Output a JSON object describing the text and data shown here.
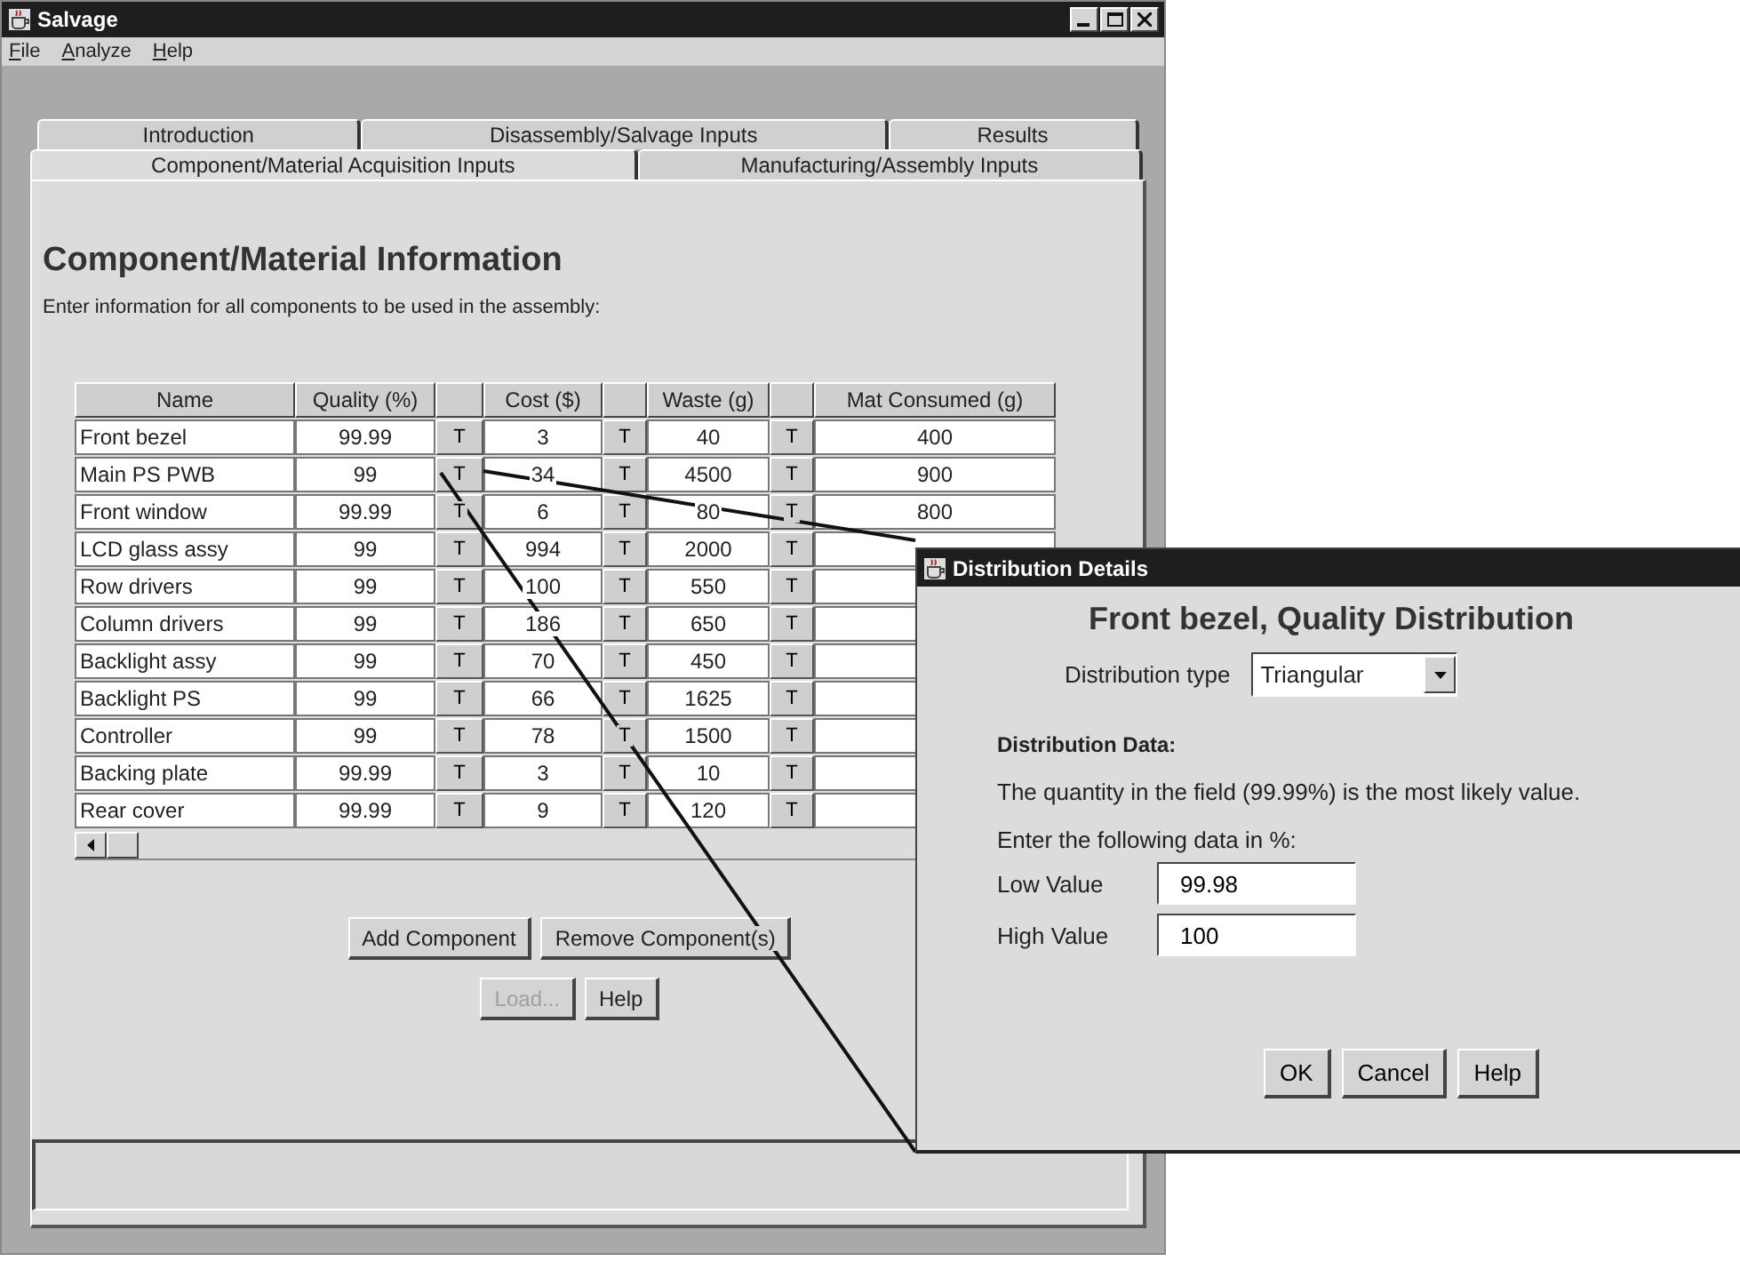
{
  "window": {
    "title": "Salvage"
  },
  "menu": [
    {
      "label": "File"
    },
    {
      "label": "Analyze"
    },
    {
      "label": "Help"
    }
  ],
  "tab_rows": [
    {
      "tabs": [
        {
          "label": "Introduction",
          "selected": false
        },
        {
          "label": "Disassembly/Salvage Inputs",
          "selected": false
        },
        {
          "label": "Results",
          "selected": false
        }
      ]
    },
    {
      "tabs": [
        {
          "label": "Component/Material Acquisition Inputs",
          "selected": true
        },
        {
          "label": "Manufacturing/Assembly Inputs",
          "selected": false
        }
      ]
    }
  ],
  "heading": "Component/Material Information",
  "instructions": "Enter information for all components to be used in the assembly:",
  "table": {
    "columns": [
      "Name",
      "Quality (%)",
      "Cost ($)",
      "Waste (g)",
      "Mat Consumed (g)"
    ],
    "rows": [
      {
        "name": "Front bezel",
        "quality": "99.99",
        "cost": "3",
        "waste": "40",
        "mat": "400",
        "t_buttons": [
          "T",
          "T",
          "T"
        ]
      },
      {
        "name": "Main PS PWB",
        "quality": "99",
        "cost": "34",
        "waste": "4500",
        "mat": "900",
        "t_buttons": [
          "T",
          "T",
          "T"
        ]
      },
      {
        "name": "Front window",
        "quality": "99.99",
        "cost": "6",
        "waste": "80",
        "mat": "800",
        "t_buttons": [
          "T",
          "T",
          "T"
        ]
      },
      {
        "name": "LCD glass assy",
        "quality": "99",
        "cost": "994",
        "waste": "2000",
        "t_buttons": [
          "T",
          "T",
          "T"
        ]
      },
      {
        "name": "Row drivers",
        "quality": "99",
        "cost": "100",
        "waste": "550",
        "t_buttons": [
          "T",
          "T",
          "T"
        ]
      },
      {
        "name": "Column drivers",
        "quality": "99",
        "cost": "186",
        "waste": "650",
        "t_buttons": [
          "T",
          "T",
          "T"
        ]
      },
      {
        "name": "Backlight assy",
        "quality": "99",
        "cost": "70",
        "waste": "450",
        "t_buttons": [
          "T",
          "T",
          "T"
        ]
      },
      {
        "name": "Backlight PS",
        "quality": "99",
        "cost": "66",
        "waste": "1625",
        "t_buttons": [
          "T",
          "T",
          "T"
        ]
      },
      {
        "name": "Controller",
        "quality": "99",
        "cost": "78",
        "waste": "1500",
        "t_buttons": [
          "T",
          "T",
          "T"
        ]
      },
      {
        "name": "Backing plate",
        "quality": "99.99",
        "cost": "3",
        "waste": "10",
        "t_buttons": [
          "T",
          "T",
          "T"
        ]
      },
      {
        "name": "Rear cover",
        "quality": "99.99",
        "cost": "9",
        "waste": "120",
        "t_buttons": [
          "T",
          "T",
          "T"
        ]
      }
    ]
  },
  "buttons": [
    [
      {
        "label": "Add Component",
        "disabled": false
      },
      {
        "label": "Remove Component(s)",
        "disabled": false
      }
    ],
    [
      {
        "label": "Load...",
        "disabled": true
      },
      {
        "label": "Help",
        "disabled": false
      }
    ]
  ],
  "dialog": {
    "title": "Distribution Details",
    "heading": "Front bezel, Quality Distribution",
    "type_label": "Distribution type",
    "type_value": "Triangular",
    "section": "Distribution Data:",
    "note": "The quantity in the field (99.99%) is the most likely value.",
    "prompt": "Enter the following data in %:",
    "fields": [
      {
        "label": "Low Value",
        "value": "99.98"
      },
      {
        "label": "High Value",
        "value": "100"
      }
    ],
    "buttons": [
      "OK",
      "Cancel",
      "Help"
    ]
  }
}
